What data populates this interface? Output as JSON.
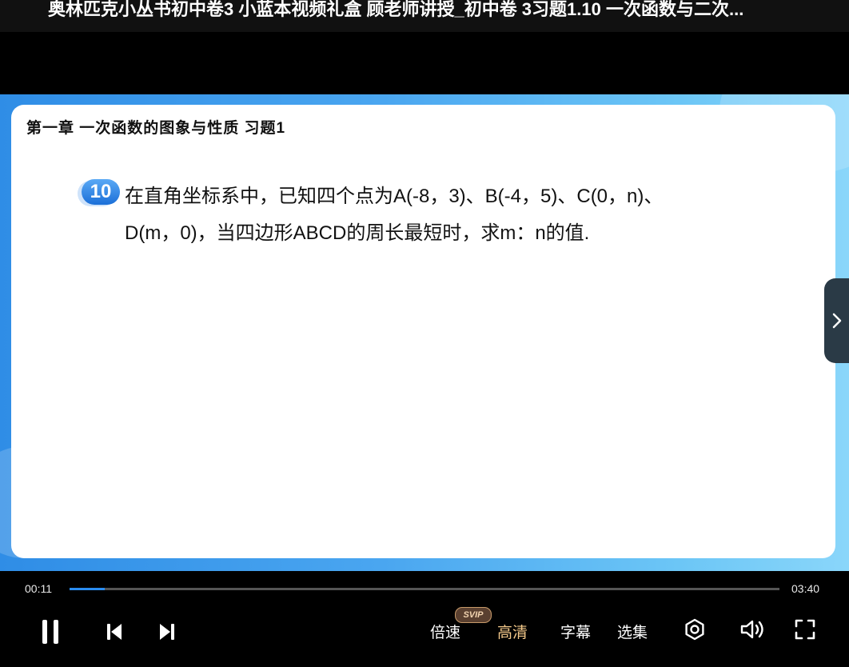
{
  "window": {
    "title": "奥林匹克小丛书初中卷3 小蓝本视频礼盒 顾老师讲授_初中卷 3习题1.10 一次函数与二次..."
  },
  "slide": {
    "chapter": "第一章 一次函数的图象与性质 习题1",
    "question_number": "10",
    "question_line1": "在直角坐标系中，已知四个点为A(-8，3)、B(-4，5)、C(0，n)、",
    "question_line2": "D(m，0)，当四边形ABCD的周长最短时，求m：n的值."
  },
  "player": {
    "current_time": "00:11",
    "total_time": "03:40",
    "progress_fraction": 0.05,
    "speed_label": "倍速",
    "svip_badge": "SVIP",
    "quality_label": "高清",
    "subtitle_label": "字幕",
    "episodes_label": "选集",
    "accent_color": "#2a8cf0",
    "active_color": "#f4c98a"
  },
  "icons": {
    "pause": "pause-icon",
    "previous": "skip-previous-icon",
    "next": "skip-next-icon",
    "settings": "settings-icon",
    "volume": "volume-icon",
    "fullscreen": "fullscreen-icon",
    "side_next": "chevron-right-icon"
  }
}
